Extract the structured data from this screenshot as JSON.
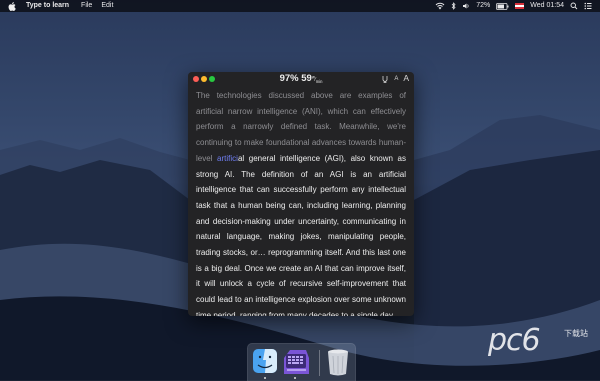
{
  "menubar": {
    "app_name": "Type to learn",
    "menus": [
      "File",
      "Edit"
    ],
    "battery": "72%",
    "datetime": "Wed 01:54"
  },
  "window": {
    "accuracy": "97%",
    "speed": "59",
    "speed_unit_top": "w",
    "speed_unit_bottom": "min",
    "font_smaller_label": "A",
    "font_larger_label": "A",
    "passage": {
      "typed": "The technologies discussed above are examples of artificial narrow intelligence (ANI), which can effectively perform a narrowly defined task. Meanwhile, we're continuing to make foundational advances towards human-level ",
      "current": "artifici",
      "remaining": "al general intelligence (AGI), also known as strong AI. The definition of an AGI is an artificial intelligence that can successfully perform any intellectual task that a human being can, including learning, planning and decision-making under uncertainty, communicating in natural language, making jokes, manipulating people, trading stocks, or… reprogramming itself. And this last one is a big deal. Once we create an AI that can improve itself, it will unlock a cycle of recursive self-improvement that could lead to an intelligence explosion over some unknown time period, ranging from many decades to a single day."
    }
  },
  "dock": {
    "items": [
      "finder-icon",
      "type-to-learn-app-icon",
      "trash-icon"
    ]
  },
  "watermark": {
    "text": "pc6",
    "sub": "下载站"
  },
  "colors": {
    "typed_text": "#8e8e92",
    "current_word": "#6f7ef2",
    "remaining_text": "#eeeeee",
    "window_bg": "#232325"
  }
}
